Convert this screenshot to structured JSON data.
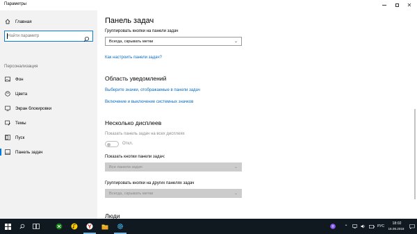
{
  "window": {
    "title": "Параметры",
    "min_icon": "minimize-icon",
    "max_icon": "maximize-icon",
    "close_icon": "close-icon"
  },
  "sidebar": {
    "home": {
      "label": "Главная",
      "icon": "home-icon"
    },
    "search": {
      "placeholder": "Найти параметр",
      "icon": "search-icon"
    },
    "section_label": "Персонализация",
    "items": [
      {
        "label": "Фон",
        "icon": "picture-icon",
        "active": false
      },
      {
        "label": "Цвета",
        "icon": "palette-icon",
        "active": false
      },
      {
        "label": "Экран блокировки",
        "icon": "lock-screen-icon",
        "active": false
      },
      {
        "label": "Темы",
        "icon": "brush-icon",
        "active": false
      },
      {
        "label": "Пуск",
        "icon": "start-icon",
        "active": false
      },
      {
        "label": "Панель задач",
        "icon": "taskbar-icon",
        "active": true
      }
    ],
    "accent_color": "#0078d7"
  },
  "main": {
    "title": "Панель задач",
    "group_label": "Группировать кнопки на панели задач",
    "group_value": "Всегда, скрывать метки",
    "howto_link": "Как настроить панели задач?",
    "notif_heading": "Область уведомлений",
    "notif_link1": "Выберите значки, отображаемые в панели задач",
    "notif_link2": "Включение и выключение системных значков",
    "multi_heading": "Несколько дисплеев",
    "multi_show_label": "Показать панель задач на всех дисплеях",
    "toggle_state": "Откл.",
    "show_buttons_label": "Показать кнопки панели задач:",
    "show_buttons_value": "Все панели задач",
    "other_group_label": "Группировать кнопки на других панелях задач",
    "other_group_value": "Всегда, скрывать метки",
    "people_heading": "Люди",
    "link_color": "#0a6cbd"
  },
  "taskbar": {
    "start_icon": "windows-start-icon",
    "search_icon": "search-icon",
    "taskview_icon": "task-view-icon",
    "apps": [
      {
        "name": "xbox-icon"
      },
      {
        "name": "yandex-browser-icon"
      },
      {
        "name": "file-explorer-icon"
      },
      {
        "name": "store-icon"
      },
      {
        "name": "settings-icon"
      }
    ],
    "tray": {
      "alice_icon": "alice-icon",
      "lang": "РУС",
      "time": "18:02",
      "date": "16.06.2018"
    },
    "bg_color": "#101820"
  }
}
